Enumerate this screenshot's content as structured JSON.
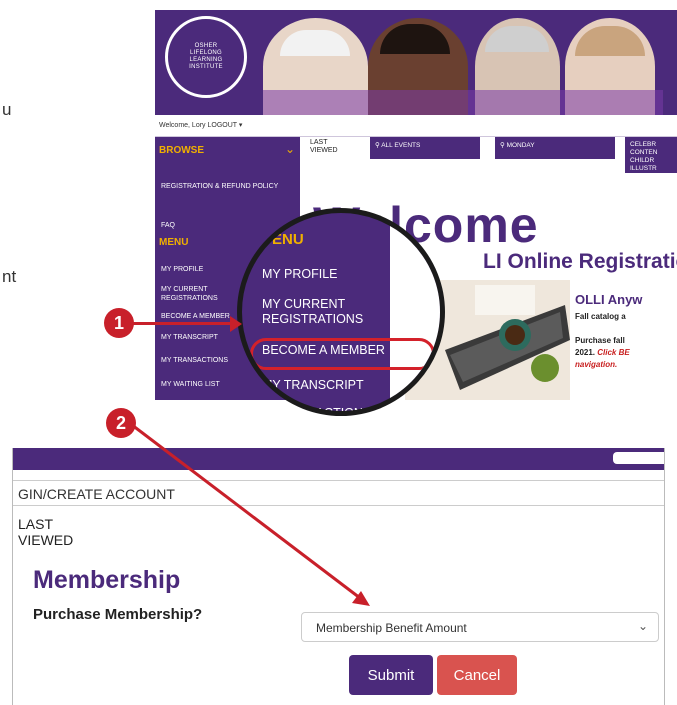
{
  "side_fragments": {
    "a": "u",
    "b": "nt"
  },
  "banner": {
    "logo_lines": [
      "OSHER",
      "LIFELONG",
      "LEARNING",
      "INSTITUTE"
    ]
  },
  "welcome_bar": "Welcome, Lory  LOGOUT ▾",
  "sidebar": {
    "browse_label": "BROWSE",
    "links": [
      "REGISTRATION & REFUND POLICY",
      "FAQ"
    ],
    "menu_label": "MENU",
    "menu_items": [
      "MY PROFILE",
      "MY CURRENT REGISTRATIONS",
      "BECOME A MEMBER",
      "MY TRANSCRIPT",
      "MY TRANSACTIONS",
      "MY WAITING LIST"
    ]
  },
  "tabs": {
    "last_viewed": "LAST VIEWED",
    "all_events": "ALL EVENTS",
    "monday": "MONDAY",
    "celebr": "CELEBR CONTEN CHILDR ILLUSTR"
  },
  "hero": {
    "welcome": "Welcome",
    "registration": "LI Online Registration",
    "olli_anyw": "OLLI Anyw",
    "fall_catalog": "Fall catalog a",
    "purchase_fall_1": "Purchase fall",
    "purchase_fall_2a": "2021. ",
    "purchase_fall_2b": "Click BE",
    "purchase_fall_3": "navigation."
  },
  "magnifier": {
    "menu_label": "ENU",
    "items": [
      "MY PROFILE",
      "MY CURRENT",
      "REGISTRATIONS",
      "BECOME A MEMBER",
      "MY TRANSCRIPT",
      "Y TRANSACTIONS"
    ]
  },
  "callouts": {
    "one": "1",
    "two": "2"
  },
  "membership_page": {
    "login_label": "GIN/CREATE ACCOUNT",
    "last_viewed": "LAST VIEWED",
    "title": "Membership",
    "question": "Purchase Membership?",
    "select_value": "Membership Benefit Amount",
    "submit_label": "Submit",
    "cancel_label": "Cancel"
  },
  "colors": {
    "brand_purple": "#4b2a7b",
    "accent_gold": "#f0b000",
    "callout_red": "#c8202a",
    "cancel_red": "#d9534f"
  }
}
